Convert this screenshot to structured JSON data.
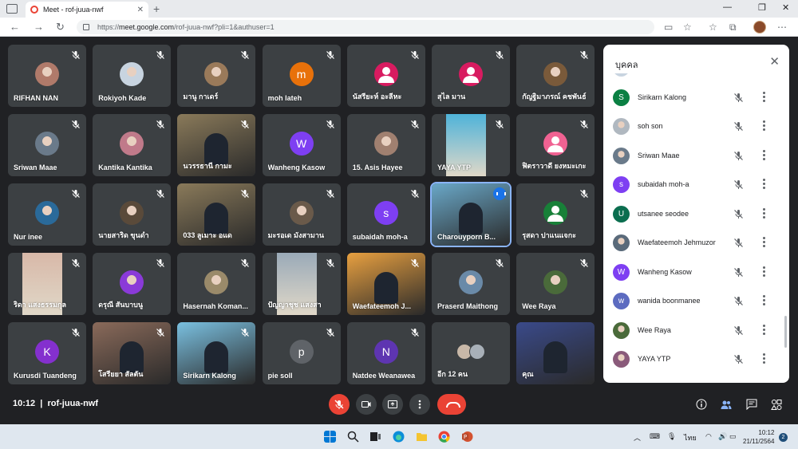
{
  "browser": {
    "tab_title": "Meet - rof-juua-nwf",
    "url_scheme": "https://",
    "url_host": "meet.google.com",
    "url_path": "/rof-juua-nwf?pli=1&authuser=1"
  },
  "colors": {
    "accent_blue": "#1a73e8",
    "mute_red": "#ea4335",
    "tile_bg": "#3c4043",
    "meet_bg": "#202124"
  },
  "tiles": [
    {
      "name": "RIFHAN NAN",
      "type": "photo",
      "color": "#b07a6a"
    },
    {
      "name": "Rokiyoh Kade",
      "type": "photo",
      "color": "#c8d4e0"
    },
    {
      "name": "มานู กาเดร์",
      "type": "photo",
      "color": "#9a7a5a"
    },
    {
      "name": "moh lateh",
      "type": "letter",
      "letter": "m",
      "color": "#e8710a"
    },
    {
      "name": "นัสรียะห์ อะลีหะ",
      "type": "person",
      "color": "#d81b60"
    },
    {
      "name": "สุไล มาน",
      "type": "person",
      "color": "#d81b60"
    },
    {
      "name": "กัญฐิมาภรณ์ คชพันธ์",
      "type": "photo",
      "color": "#7a5a3a"
    },
    {
      "name": "Sriwan Maae",
      "type": "photo",
      "color": "#6a7a8a"
    },
    {
      "name": "Kantika Kantika",
      "type": "photo",
      "color": "#c07a8a"
    },
    {
      "name": "นวรรธานี กามะ",
      "type": "video",
      "color": "#8a7a5a"
    },
    {
      "name": "Wanheng Kasow",
      "type": "letter",
      "letter": "W",
      "color": "#7e3ff2"
    },
    {
      "name": "15. Asis Hayee",
      "type": "photo",
      "color": "#a08070"
    },
    {
      "name": "YAYA YTP",
      "type": "portrait",
      "color": "#4fb3d9"
    },
    {
      "name": "ฟิตราวาดี ยงหมะเกะ",
      "type": "person",
      "color": "#f06292"
    },
    {
      "name": "Nur inee",
      "type": "photo",
      "color": "#2a6a9a"
    },
    {
      "name": "นายสาริด ขุนดำ",
      "type": "photo",
      "color": "#5a4a3a"
    },
    {
      "name": "033 ลูเมาะ อแด",
      "type": "video",
      "color": "#8a7a5a"
    },
    {
      "name": "มะรอเด มังสามาน",
      "type": "photo",
      "color": "#6a5a4a"
    },
    {
      "name": "subaidah moh-a",
      "type": "letter",
      "letter": "s",
      "color": "#7e3ff2"
    },
    {
      "name": "Charouyporn B...",
      "type": "speaking",
      "color": "#6aa8c8"
    },
    {
      "name": "รุสดา ปาแนแจกะ",
      "type": "person",
      "color": "#188038"
    },
    {
      "name": "ริดา แสงธรรมกุล",
      "type": "portrait",
      "color": "#d8b8a8"
    },
    {
      "name": "ดรุณี สันบาบนู",
      "type": "photo",
      "color": "#8a3ad8"
    },
    {
      "name": "Hasernah Koman...",
      "type": "photo",
      "color": "#9a8a6a"
    },
    {
      "name": "ปัญญาชุช แสงสา",
      "type": "portrait",
      "color": "#9aaab8"
    },
    {
      "name": "Waefateemoh J...",
      "type": "video",
      "color": "#e8a040"
    },
    {
      "name": "Praserd Maithong",
      "type": "photo",
      "color": "#6a8aa8"
    },
    {
      "name": "Wee Raya",
      "type": "photo",
      "color": "#4a6a3a"
    },
    {
      "name": "Kurusdi Tuandeng",
      "type": "letter",
      "letter": "K",
      "color": "#8430ce"
    },
    {
      "name": "โสรียยา สัลตัน",
      "type": "video",
      "color": "#8a6a5a"
    },
    {
      "name": "Sirikarn Kalong",
      "type": "video",
      "color": "#7ac0e0"
    },
    {
      "name": "pie soll",
      "type": "letter",
      "letter": "p",
      "color": "#5f6368"
    },
    {
      "name": "Natdee Weanawea",
      "type": "letter",
      "letter": "N",
      "color": "#5e35b1"
    },
    {
      "name": "อีก 12 คน",
      "type": "more",
      "color": "#3c4043"
    },
    {
      "name": "คุณ",
      "type": "self",
      "color": "#3a4a8a"
    }
  ],
  "bottom_bar": {
    "time": "10:12",
    "separator": "|",
    "meeting_code": "rof-juua-nwf",
    "participant_count": "46"
  },
  "people_panel": {
    "title": "บุคคล",
    "items": [
      {
        "name": "Rokiyoh Kade",
        "type": "photo",
        "color": "#c8d4e0"
      },
      {
        "name": "Sirikarn Kalong",
        "type": "letter",
        "letter": "S",
        "color": "#0b8043"
      },
      {
        "name": "soh son",
        "type": "photo",
        "color": "#b0b8c0"
      },
      {
        "name": "Sriwan Maae",
        "type": "photo",
        "color": "#6a7a8a"
      },
      {
        "name": "subaidah moh-a",
        "type": "letter",
        "letter": "s",
        "color": "#7e3ff2"
      },
      {
        "name": "utsanee seodee",
        "type": "letter",
        "letter": "U",
        "color": "#0b6e4f"
      },
      {
        "name": "Waefateemoh Jehmuzor",
        "type": "photo",
        "color": "#5a6a7a"
      },
      {
        "name": "Wanheng Kasow",
        "type": "letter",
        "letter": "W",
        "color": "#7e3ff2"
      },
      {
        "name": "wanida boonmanee",
        "type": "letter",
        "letter": "w",
        "color": "#5c6bc0"
      },
      {
        "name": "Wee Raya",
        "type": "photo",
        "color": "#4a6a3a"
      },
      {
        "name": "YAYA YTP",
        "type": "photo",
        "color": "#8a5a7a"
      }
    ]
  },
  "taskbar": {
    "lang": "ไทย",
    "time": "10:12",
    "date": "21/11/2564",
    "notifications": "2"
  }
}
